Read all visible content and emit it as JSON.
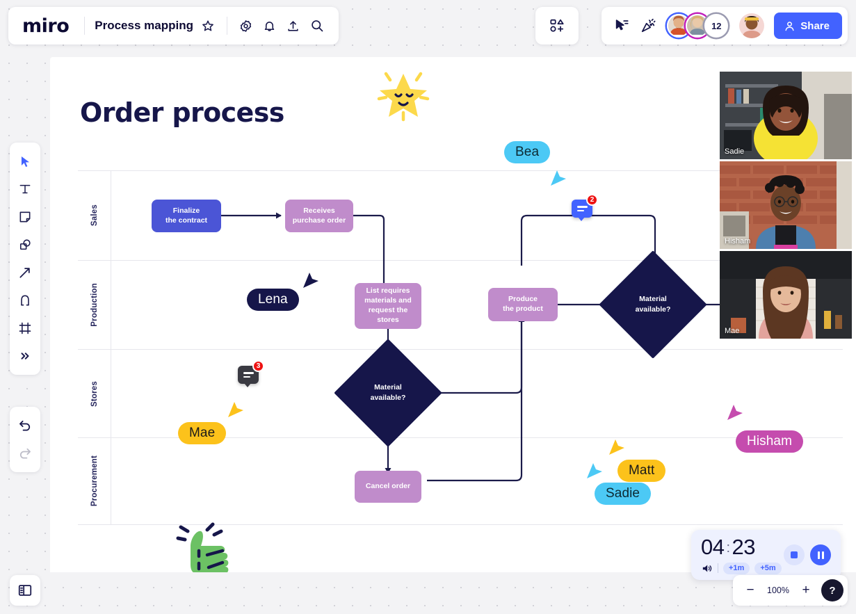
{
  "app": {
    "logo": "miro",
    "board_name": "Process mapping"
  },
  "topbar": {
    "icons": [
      {
        "name": "star-icon",
        "glyph": "☆"
      },
      {
        "name": "gear-icon",
        "glyph": "gear"
      },
      {
        "name": "bell-icon",
        "glyph": "bell"
      },
      {
        "name": "upload-icon",
        "glyph": "upload"
      },
      {
        "name": "search-icon",
        "glyph": "search"
      }
    ],
    "apps_icon": "apps-grid-icon",
    "cursor_share_icon": "cursor-share-icon",
    "celebrate_icon": "party-popper-icon",
    "collaborator_overflow_count": "12",
    "share_label": "Share",
    "share_color": "#4262ff"
  },
  "left_toolbar": {
    "tools": [
      {
        "name": "select-tool",
        "label": "Select",
        "active": true
      },
      {
        "name": "text-tool",
        "label": "Text",
        "active": false
      },
      {
        "name": "sticky-note-tool",
        "label": "Sticky note",
        "active": false
      },
      {
        "name": "shapes-tool",
        "label": "Shapes",
        "active": false
      },
      {
        "name": "connection-line-tool",
        "label": "Connection line",
        "active": false
      },
      {
        "name": "pen-tool",
        "label": "Pen",
        "active": false
      },
      {
        "name": "frame-tool",
        "label": "Frame",
        "active": false
      },
      {
        "name": "more-tools",
        "label": "More tools",
        "active": false
      }
    ],
    "history": [
      {
        "name": "undo-button",
        "label": "Undo",
        "enabled": true
      },
      {
        "name": "redo-button",
        "label": "Redo",
        "enabled": false
      }
    ],
    "panel_toggle": "open-panel-icon"
  },
  "canvas": {
    "title": "Order process",
    "stickers": [
      {
        "name": "star-sticker",
        "kind": "smiling-star",
        "color": "#fcd949"
      },
      {
        "name": "thumbs-up-sticker",
        "kind": "thumbs-up",
        "color": "#6cc164"
      }
    ],
    "swimlanes": [
      "Sales",
      "Production",
      "Stores",
      "Procurement"
    ],
    "nodes": [
      {
        "id": "n1",
        "label": "Finalize\nthe contract",
        "lane": "Sales",
        "shape": "rounded-rect",
        "color": "#4b55d6"
      },
      {
        "id": "n2",
        "label": "Receives\npurchase order",
        "lane": "Sales",
        "shape": "rounded-rect",
        "color": "#c08ccb"
      },
      {
        "id": "n3",
        "label": "List requires\nmaterials and\nrequest the stores",
        "lane": "Production",
        "shape": "rounded-rect",
        "color": "#c08ccb"
      },
      {
        "id": "n4",
        "label": "Produce\nthe product",
        "lane": "Production",
        "shape": "rounded-rect",
        "color": "#c08ccb"
      },
      {
        "id": "n5",
        "label": "Material\navailable?",
        "lane": "Production",
        "shape": "diamond",
        "color": "#16164a"
      },
      {
        "id": "n6",
        "label": "Material\navailable?",
        "lane": "Stores",
        "shape": "diamond",
        "color": "#16164a"
      },
      {
        "id": "n7",
        "label": "Cancel order",
        "lane": "Procurement",
        "shape": "rounded-rect",
        "color": "#c08ccb"
      }
    ],
    "node_text": {
      "n1_l1": "Finalize",
      "n1_l2": "the contract",
      "n2_l1": "Receives",
      "n2_l2": "purchase order",
      "n3_l1": "List requires",
      "n3_l2": "materials and",
      "n3_l3": "request the stores",
      "n4_l1": "Produce",
      "n4_l2": "the product",
      "n5_l1": "Material",
      "n5_l2": "available?",
      "n6_l1": "Material",
      "n6_l2": "available?",
      "n7_l1": "Cancel order"
    },
    "cursors": [
      {
        "name": "Bea",
        "color": "#4cc9f5",
        "text_color": "#0d2a33"
      },
      {
        "name": "Lena",
        "color": "#16164a",
        "text_color": "#ffffff"
      },
      {
        "name": "Mae",
        "color": "#fcc21b",
        "text_color": "#1a1a1a"
      },
      {
        "name": "Hisham",
        "color": "#c54cae",
        "text_color": "#ffffff"
      },
      {
        "name": "Matt",
        "color": "#fcc21b",
        "text_color": "#1a1a1a"
      },
      {
        "name": "Sadie",
        "color": "#4cc9f5",
        "text_color": "#0d2a33"
      }
    ],
    "comments": [
      {
        "name": "comment-badge-blue",
        "count": "2",
        "color": "#4262ff"
      },
      {
        "name": "comment-badge-dark",
        "count": "3",
        "color": "#3a3a42"
      }
    ]
  },
  "video_panel": [
    {
      "name": "Sadie",
      "tile": "video-tile-sadie"
    },
    {
      "name": "Hisham",
      "tile": "video-tile-hisham"
    },
    {
      "name": "Mae",
      "tile": "video-tile-mae"
    }
  ],
  "timer": {
    "minutes": "04",
    "separator": ":",
    "seconds": "23",
    "add_1m": "+1m",
    "add_5m": "+5m",
    "volume_icon": "volume-icon",
    "stop_label": "Stop",
    "pause_label": "Pause",
    "close_label": "×"
  },
  "zoom_bar": {
    "minus": "−",
    "level": "100%",
    "plus": "+",
    "help": "?"
  }
}
